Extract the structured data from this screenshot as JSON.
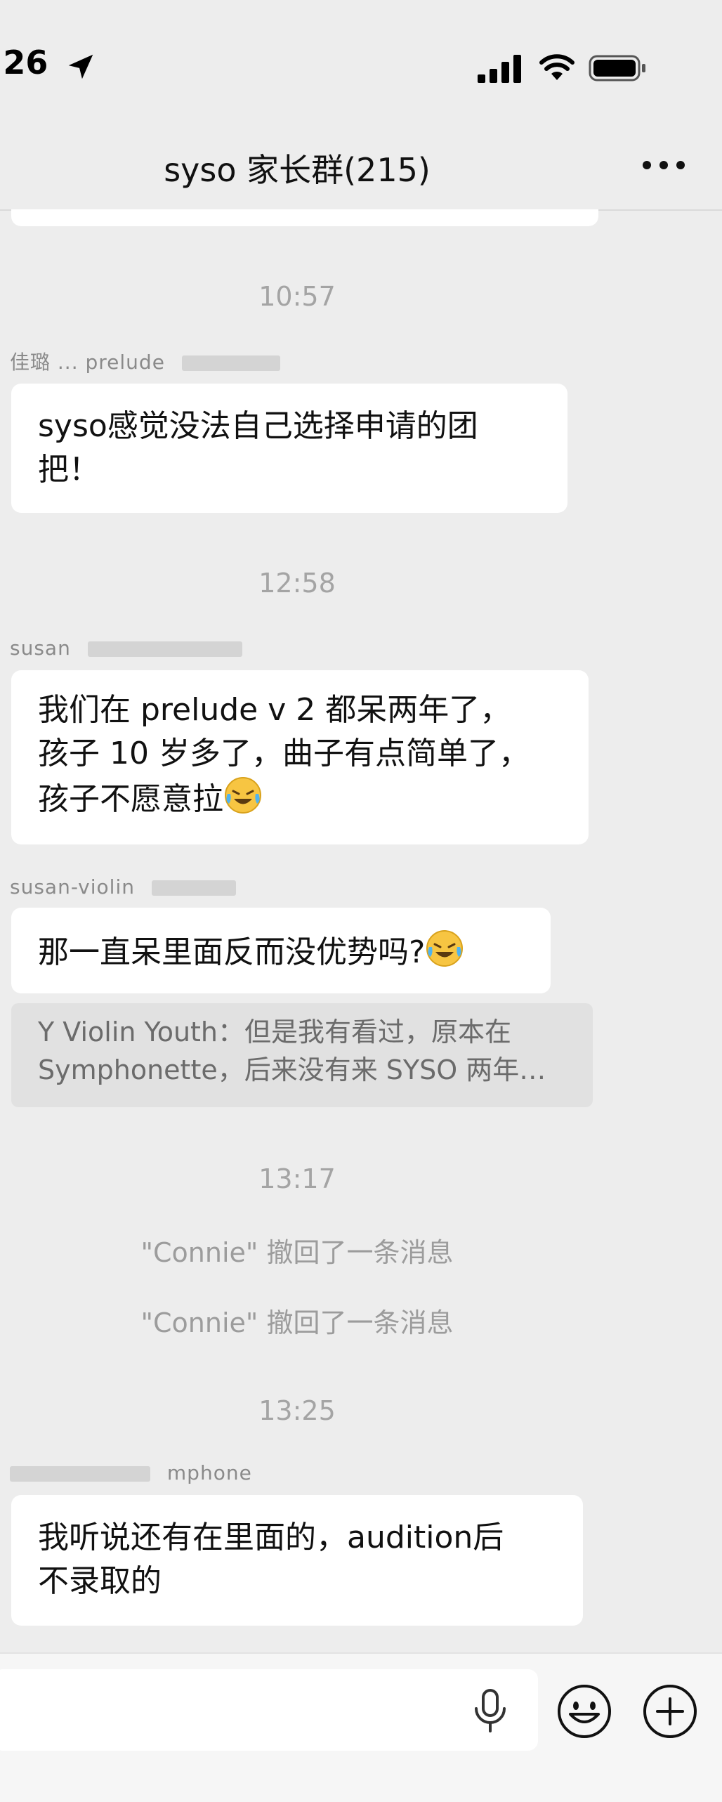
{
  "status_bar": {
    "time": ":26",
    "icons": [
      "location-arrow-icon",
      "signal-icon",
      "wifi-icon",
      "battery-icon"
    ]
  },
  "header": {
    "title": "syso 家长群(215)",
    "more_icon": "more-icon"
  },
  "messages": {
    "t1": "10:57",
    "m1_sender": "佳璐 ... prelude",
    "m1_line1": "syso感觉没法自己选择申请的团",
    "m1_line2": "把！",
    "t2": "12:58",
    "m2_sender": "susan",
    "m2_line1": "我们在 prelude v 2 都呆两年了，",
    "m2_line2": "孩子 10 岁多了，曲子有点简单了，",
    "m2_line3": "孩子不愿意拉",
    "m3_sender": "susan-violin",
    "m3_line1": "那一直呆里面反而没优势吗?",
    "quote_line1": "Y Violin Youth：但是我有看过，原本在",
    "quote_line2": "Symphonette，后来没有来 SYSO 两年…",
    "t3": "13:17",
    "recall1": "\"Connie\" 撤回了一条消息",
    "recall2": "\"Connie\" 撤回了一条消息",
    "t4": "13:25",
    "m4_sender": "mphone",
    "m4_line1": "我听说还有在里面的，audition后",
    "m4_line2": "不录取的"
  },
  "input_bar": {
    "icons": [
      "microphone-icon",
      "sticker-icon",
      "plus-icon"
    ]
  },
  "colors": {
    "background": "#ededed",
    "bubble": "#ffffff",
    "timestamp": "#a4a4a4",
    "quote_bg": "#e1e1e1"
  }
}
